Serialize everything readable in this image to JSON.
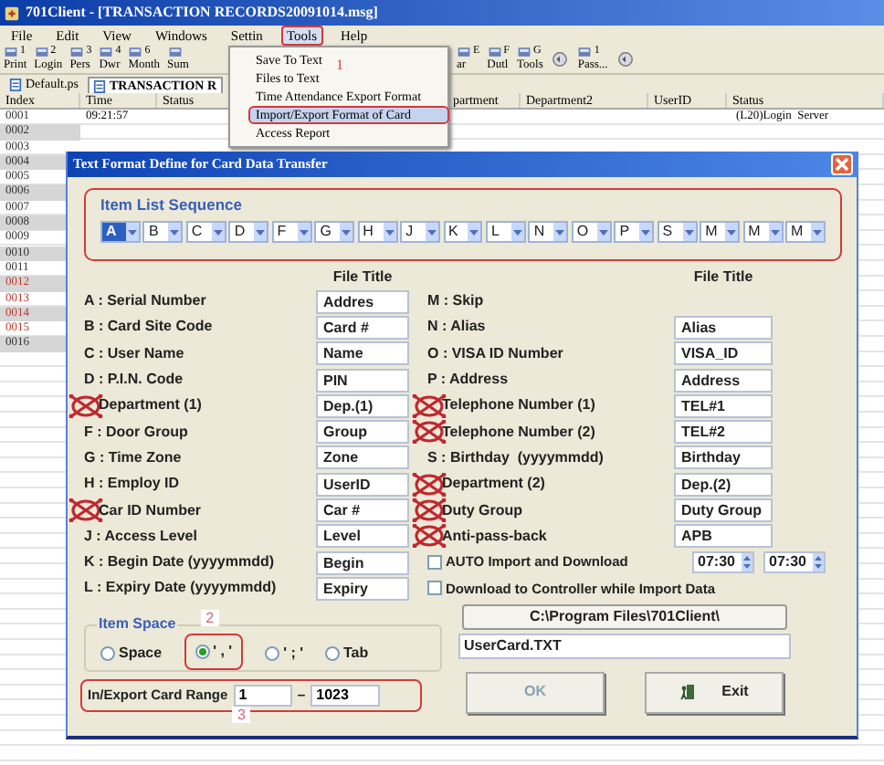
{
  "window": {
    "title": "701Client - [TRANSACTION RECORDS20091014.msg]"
  },
  "menu": [
    {
      "label": "File",
      "selected": false
    },
    {
      "label": "Edit",
      "selected": false
    },
    {
      "label": "View",
      "selected": false
    },
    {
      "label": "Windows",
      "selected": false
    },
    {
      "label": "Settin",
      "selected": false
    },
    {
      "label": "Tools",
      "selected": true
    },
    {
      "label": "Help",
      "selected": false
    }
  ],
  "toolbar": {
    "left": [
      {
        "number": "1",
        "label": "Print"
      },
      {
        "number": "2",
        "label": "Login"
      },
      {
        "number": "3",
        "label": "Pers"
      },
      {
        "number": "4",
        "label": "Dwr"
      },
      {
        "number": "6",
        "label": "Month"
      },
      {
        "label": "Sum"
      }
    ],
    "right": [
      {
        "number": "E",
        "label": "ar"
      },
      {
        "number": "F",
        "label": "Dutl"
      },
      {
        "number": "G",
        "label": "Tools"
      },
      {
        "kind": "arrow"
      },
      {
        "number": "1",
        "label": "Pass..."
      },
      {
        "kind": "arrow"
      }
    ]
  },
  "tabs": [
    {
      "label": "Default.ps",
      "selected": false
    },
    {
      "label": "TRANSACTION R",
      "selected": true
    }
  ],
  "table": {
    "columns": [
      "Index",
      "Time",
      "Status",
      "partment",
      "Department2",
      "UserID",
      "Status"
    ],
    "rows": [
      {
        "index": "0001",
        "time": "09:21:57",
        "status": "(L20)Login  Server",
        "alert": false
      },
      {
        "index": "0002",
        "alert": false
      },
      {
        "index": "0003",
        "alert": false
      },
      {
        "index": "0004",
        "alert": false
      },
      {
        "index": "0005",
        "alert": false
      },
      {
        "index": "0006",
        "alert": false
      },
      {
        "index": "0007",
        "alert": false
      },
      {
        "index": "0008",
        "alert": false
      },
      {
        "index": "0009",
        "alert": false
      },
      {
        "index": "0010",
        "alert": false
      },
      {
        "index": "0011",
        "alert": false
      },
      {
        "index": "0012",
        "alert": true
      },
      {
        "index": "0013",
        "alert": true
      },
      {
        "index": "0014",
        "alert": true
      },
      {
        "index": "0015",
        "alert": true
      },
      {
        "index": "0016",
        "alert": false
      }
    ]
  },
  "tools_menu": {
    "annotation": "1",
    "items": [
      {
        "label": "Save To Text",
        "selected": false
      },
      {
        "label": "Files to Text",
        "selected": false
      },
      {
        "label": "Time Attendance Export Format",
        "selected": false
      },
      {
        "label": "Import/Export Format of Card",
        "selected": true
      },
      {
        "label": "Access Report",
        "selected": false
      }
    ]
  },
  "dialog": {
    "title": "Text Format Define for Card Data Transfer",
    "item_list": {
      "title": "Item List Sequence",
      "items": [
        {
          "value": "A",
          "selected": true
        },
        {
          "value": "B",
          "selected": false
        },
        {
          "value": "C",
          "selected": false
        },
        {
          "value": "D",
          "selected": false
        },
        {
          "value": "F",
          "selected": false
        },
        {
          "value": "G",
          "selected": false
        },
        {
          "value": "H",
          "selected": false
        },
        {
          "value": "J",
          "selected": false
        },
        {
          "value": "K",
          "selected": false
        },
        {
          "value": "L",
          "selected": false
        },
        {
          "value": "N",
          "selected": false
        },
        {
          "value": "O",
          "selected": false
        },
        {
          "value": "P",
          "selected": false
        },
        {
          "value": "S",
          "selected": false
        },
        {
          "value": "M",
          "selected": false
        },
        {
          "value": "M",
          "selected": false
        },
        {
          "value": "M",
          "selected": false
        }
      ]
    },
    "left_header": "File Title",
    "right_header": "File Title",
    "left_fields": [
      {
        "label": "A : Serial Number",
        "value": "Addres",
        "crossed": false
      },
      {
        "label": "B : Card Site Code",
        "value": "Card #",
        "crossed": false
      },
      {
        "label": "C : User Name",
        "value": "Name",
        "crossed": false
      },
      {
        "label": "D : P.I.N. Code",
        "value": "PIN",
        "crossed": false
      },
      {
        "label": "Department (1)",
        "value": "Dep.(1)",
        "crossed": true
      },
      {
        "label": "F : Door Group",
        "value": "Group",
        "crossed": false
      },
      {
        "label": "G : Time Zone",
        "value": "Zone",
        "crossed": false
      },
      {
        "label": "H : Employ ID",
        "value": "UserID",
        "crossed": false
      },
      {
        "label": "Car ID Number",
        "value": "Car #",
        "crossed": true
      },
      {
        "label": "J : Access Level",
        "value": "Level",
        "crossed": false
      },
      {
        "label": "K : Begin Date (yyyymmdd)",
        "value": "Begin",
        "crossed": false
      },
      {
        "label": "L : Expiry Date (yyyymmdd)",
        "value": "Expiry",
        "crossed": false
      }
    ],
    "right_fields": [
      {
        "label": "M : Skip",
        "crossed": false
      },
      {
        "label": "N : Alias",
        "value": "Alias",
        "crossed": false
      },
      {
        "label": "O : VISA ID Number",
        "value": "VISA_ID",
        "crossed": false
      },
      {
        "label": "P : Address",
        "value": "Address",
        "crossed": false
      },
      {
        "label": "Telephone Number (1)",
        "value": "TEL#1",
        "crossed": true
      },
      {
        "label": "Telephone Number (2)",
        "value": "TEL#2",
        "crossed": true
      },
      {
        "label": "S : Birthday  (yyyymmdd)",
        "value": "Birthday",
        "crossed": false
      },
      {
        "label": "Department (2)",
        "value": "Dep.(2)",
        "crossed": true
      },
      {
        "label": "Duty Group",
        "value": "Duty Group",
        "crossed": true
      },
      {
        "label": "Anti-pass-back",
        "value": "APB",
        "crossed": true
      }
    ],
    "options": [
      {
        "label": "AUTO Import and Download",
        "checked": false,
        "times": [
          "07:30",
          "07:30"
        ]
      },
      {
        "label": "Download to Controller while Import Data",
        "checked": false
      }
    ],
    "path_button": "C:\\Program Files\\701Client\\",
    "file_name": "UserCard.TXT",
    "buttons": [
      {
        "label": "OK",
        "disabled": true,
        "kind": "ok"
      },
      {
        "label": "Exit",
        "disabled": false,
        "kind": "exit"
      }
    ],
    "item_space": {
      "title": "Item Space",
      "annotation": "2",
      "options": [
        {
          "label": "Space",
          "selected": false
        },
        {
          "label": "' , '",
          "selected": true
        },
        {
          "label": "' ; '",
          "selected": false
        },
        {
          "label": "Tab",
          "selected": false
        }
      ]
    },
    "card_range": {
      "label": "In/Export Card Range",
      "from": "1",
      "separator": "–",
      "to": "1023",
      "annotation": "3"
    }
  }
}
